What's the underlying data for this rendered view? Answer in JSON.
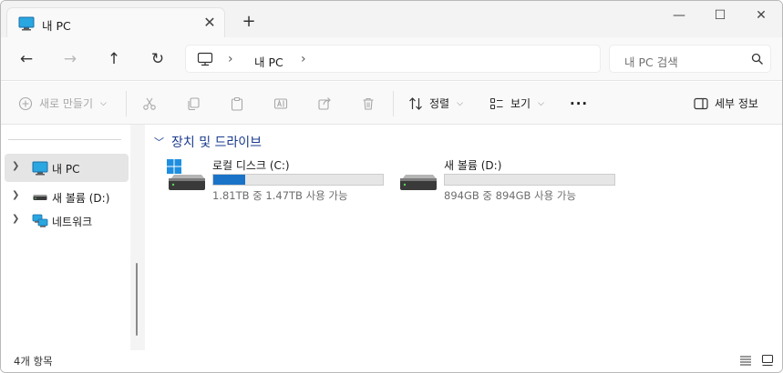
{
  "tab": {
    "title": "내 PC",
    "close": "✕",
    "new_tab": "+"
  },
  "window_controls": {
    "minimize": "—",
    "maximize": "☐",
    "close": "✕"
  },
  "nav": {
    "back": "←",
    "forward": "→",
    "up": "↑",
    "refresh": "↻",
    "address_items": [
      "내 PC"
    ],
    "separator": "›",
    "search_placeholder": "내 PC 검색"
  },
  "commands": {
    "new_label": "새로 만들기",
    "sort_label": "정렬",
    "view_label": "보기",
    "more_label": "···",
    "details_label": "세부 정보"
  },
  "sidebar": {
    "items": [
      {
        "label": "내 PC",
        "icon": "pc-icon",
        "selected": true
      },
      {
        "label": "새 볼륨 (D:)",
        "icon": "drive-icon",
        "selected": false
      },
      {
        "label": "네트워크",
        "icon": "network-icon",
        "selected": false
      }
    ]
  },
  "content": {
    "group_title": "장치 및 드라이브",
    "drives": [
      {
        "name": "로컬 디스크 (C:)",
        "info": "1.81TB 중 1.47TB 사용 가능",
        "used_fraction": 0.19,
        "windows": true
      },
      {
        "name": "새 볼륨 (D:)",
        "info": "894GB 중 894GB 사용 가능",
        "used_fraction": 0.0,
        "windows": false
      }
    ]
  },
  "status": {
    "count_text": "4개 항목"
  },
  "colors": {
    "accent": "#1a73c7",
    "group_header": "#1a3b8c",
    "selected_bg": "#e5e5e5"
  }
}
